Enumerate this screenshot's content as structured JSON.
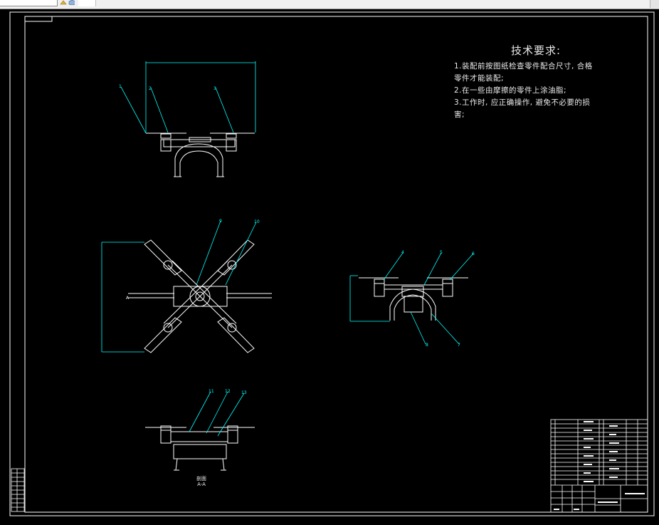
{
  "app": {
    "toolbar": {
      "layer_field_value": "",
      "icons": [
        "layer-tools-icon",
        "cube-3d-icon"
      ]
    }
  },
  "colors": {
    "background": "#000000",
    "drawing_lines": "#ffffff",
    "dimension_lines": "#00ffff",
    "text": "#e8e8e8"
  },
  "drawing": {
    "tech_requirements": {
      "title": "技术要求:",
      "lines": [
        "1.装配前按图纸检查零件配合尺寸, 合格",
        "零件才能装配;",
        "2.在一些由摩擦的零件上涂油脂;",
        "3.工作时, 应正确操作, 避免不必要的损",
        "害;"
      ]
    },
    "section": {
      "title": "剖面",
      "name": "A-A"
    },
    "view_marker": "A",
    "balloons": [
      "1",
      "2",
      "3",
      "4",
      "5",
      "6",
      "7",
      "8",
      "9",
      "10",
      "11",
      "12",
      "13"
    ]
  }
}
